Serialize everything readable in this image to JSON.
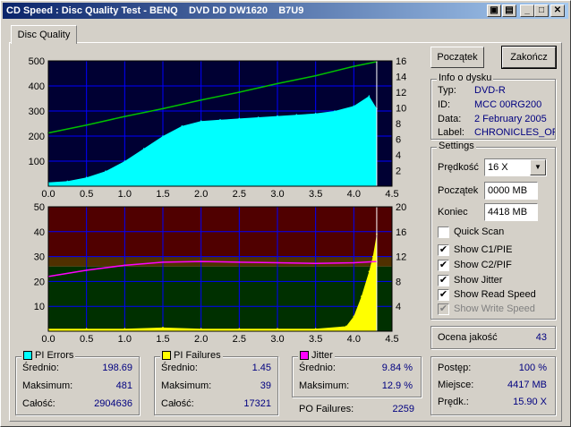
{
  "window": {
    "title": "CD Speed : Disc Quality Test - BENQ    DVD DD DW1620    B7U9",
    "buttons": [
      "▣",
      "_",
      "□",
      "✕"
    ]
  },
  "tab": {
    "label": "Disc Quality"
  },
  "buttons": {
    "start": "Początek",
    "stop": "Zakończ"
  },
  "disc_info": {
    "title": "Info o dysku",
    "rows": [
      {
        "label": "Typ:",
        "value": "DVD-R"
      },
      {
        "label": "ID:",
        "value": "MCC 00RG200"
      },
      {
        "label": "Data:",
        "value": "2 February 2005"
      },
      {
        "label": "Label:",
        "value": "CHRONICLES_OF"
      }
    ]
  },
  "settings": {
    "title": "Settings",
    "speed_label": "Prędkość",
    "speed_value": "16 X",
    "start_label": "Początek",
    "start_value": "0000 MB",
    "end_label": "Koniec",
    "end_value": "4418 MB",
    "checks": [
      {
        "label": "Quick Scan",
        "checked": false,
        "disabled": false
      },
      {
        "label": "Show C1/PIE",
        "checked": true,
        "disabled": false
      },
      {
        "label": "Show C2/PIF",
        "checked": true,
        "disabled": false
      },
      {
        "label": "Show Jitter",
        "checked": true,
        "disabled": false
      },
      {
        "label": "Show Read Speed",
        "checked": true,
        "disabled": false
      },
      {
        "label": "Show Write Speed",
        "checked": true,
        "disabled": true
      }
    ]
  },
  "quality": {
    "label": "Ocena jakość",
    "value": "43"
  },
  "progress": {
    "rows": [
      {
        "label": "Postęp:",
        "value": "100 %"
      },
      {
        "label": "Miejsce:",
        "value": "4417 MB"
      },
      {
        "label": "Prędk.:",
        "value": "15.90 X"
      }
    ]
  },
  "pi_errors": {
    "title": "PI Errors",
    "color": "#00ffff",
    "rows": [
      {
        "label": "Średnio:",
        "value": "198.69"
      },
      {
        "label": "Maksimum:",
        "value": "481"
      },
      {
        "label": "Całość:",
        "value": "2904636"
      }
    ]
  },
  "pi_failures": {
    "title": "PI Failures",
    "color": "#ffff00",
    "rows": [
      {
        "label": "Średnio:",
        "value": "1.45"
      },
      {
        "label": "Maksimum:",
        "value": "39"
      },
      {
        "label": "Całość:",
        "value": "17321"
      }
    ]
  },
  "jitter": {
    "title": "Jitter",
    "color": "#ff00ff",
    "rows": [
      {
        "label": "Średnio:",
        "value": "9.84 %"
      },
      {
        "label": "Maksimum:",
        "value": "12.9 %"
      }
    ]
  },
  "po_failures": {
    "label": "PO Failures:",
    "value": "2259"
  },
  "chart_data": [
    {
      "type": "area",
      "x_ticks": [
        "0.0",
        "0.5",
        "1.0",
        "1.5",
        "2.0",
        "2.5",
        "3.0",
        "3.5",
        "4.0",
        "4.5"
      ],
      "y_ticks_left": [
        "100",
        "200",
        "300",
        "400",
        "500"
      ],
      "y_ticks_right": [
        "2",
        "4",
        "6",
        "8",
        "10",
        "12",
        "14",
        "16"
      ],
      "xlim": [
        0,
        4.5
      ],
      "ylim": [
        0,
        500
      ],
      "y2lim": [
        0,
        16
      ],
      "series": [
        {
          "x": [
            0,
            0.25,
            0.5,
            0.75,
            1.0,
            1.25,
            1.5,
            1.75,
            2.0,
            2.25,
            2.5,
            2.75,
            3.0,
            3.25,
            3.5,
            3.75,
            4.0,
            4.2,
            4.3
          ],
          "values": [
            15,
            20,
            35,
            60,
            100,
            150,
            200,
            240,
            260,
            265,
            270,
            275,
            280,
            285,
            290,
            300,
            320,
            360,
            310
          ],
          "color": "#00ffff"
        },
        {
          "x": [
            0,
            0.5,
            1.0,
            1.5,
            2.0,
            2.5,
            3.0,
            3.5,
            4.0,
            4.3
          ],
          "values": [
            6.8,
            7.8,
            8.9,
            9.9,
            11.0,
            12.0,
            13.1,
            14.1,
            15.3,
            15.9
          ],
          "color": "#00c000",
          "axis": "right"
        }
      ]
    },
    {
      "type": "area",
      "x_ticks": [
        "0.0",
        "0.5",
        "1.0",
        "1.5",
        "2.0",
        "2.5",
        "3.0",
        "3.5",
        "4.0",
        "4.5"
      ],
      "y_ticks_left": [
        "10",
        "20",
        "30",
        "40",
        "50"
      ],
      "y_ticks_right": [
        "4",
        "8",
        "12",
        "16",
        "20"
      ],
      "xlim": [
        0,
        4.5
      ],
      "ylim": [
        0,
        50
      ],
      "y2lim": [
        0,
        20
      ],
      "series": [
        {
          "x": [
            0,
            0.5,
            1.0,
            1.5,
            2.0,
            2.5,
            3.0,
            3.5,
            3.9,
            4.0,
            4.1,
            4.2,
            4.25,
            4.3
          ],
          "values": [
            1,
            1,
            1,
            1.5,
            1,
            1,
            1,
            1,
            2,
            6,
            14,
            24,
            30,
            39
          ],
          "color": "#ffff00"
        },
        {
          "x": [
            0,
            0.5,
            1.0,
            1.5,
            2.0,
            2.5,
            3.0,
            3.5,
            4.0,
            4.3
          ],
          "values": [
            8.8,
            9.8,
            10.6,
            11.1,
            11.2,
            11.1,
            11.0,
            10.9,
            11.0,
            11.2
          ],
          "color": "#ff00ff",
          "axis": "right"
        }
      ]
    }
  ]
}
